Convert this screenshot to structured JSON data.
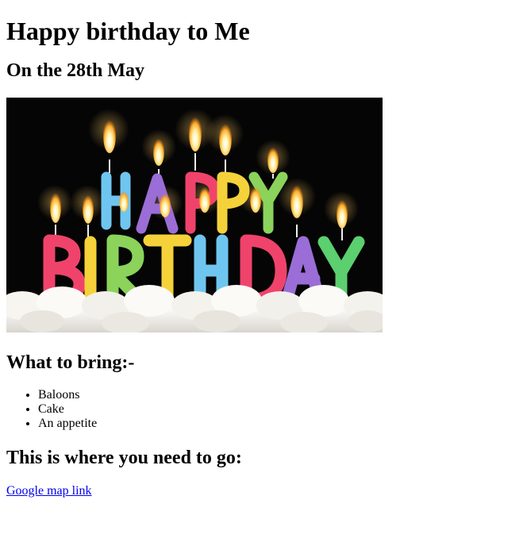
{
  "title": "Happy birthday to Me",
  "date_heading": "On the 28th May",
  "image": {
    "description_icon": "birthday-cake-candles",
    "letters_happy": [
      "H",
      "A",
      "P",
      "P",
      "Y"
    ],
    "letters_birthday": [
      "B",
      "I",
      "R",
      "T",
      "H",
      "D",
      "A",
      "Y"
    ]
  },
  "bring_heading": "What to bring:-",
  "bring_items": [
    "Baloons",
    "Cake",
    "An appetite"
  ],
  "go_heading": "This is where you need to go:",
  "map_link_label": "Google map link"
}
